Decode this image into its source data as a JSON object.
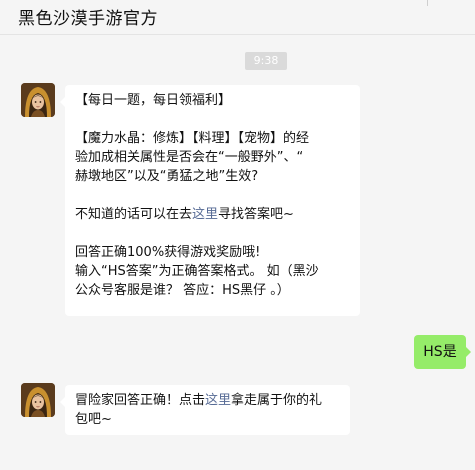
{
  "window": {
    "title": "黑色沙漠手游官方"
  },
  "chat": {
    "timestamp": "9:38",
    "message1": {
      "line1": "【每日一题，每日领福利】",
      "line2": "【魔力水晶：修炼】【料理】【宠物】的经",
      "line3": "验加成相关属性是否会在“一般野外”、“",
      "line4": "赫墩地区”以及“勇猛之地”生效?",
      "line5_before": "不知道的话可以在去",
      "line5_link": "这里",
      "line5_after": "寻找答案吧~",
      "line6": "回答正确100%获得游戏奖励哦!",
      "line7": "输入“HS答案”为正确答案格式。 如（黑沙",
      "line8": "公众号客服是谁？ 答应：HS黑仔 。）"
    },
    "user_message": "HS是",
    "message2": {
      "line1_before": "冒险家回答正确！点击",
      "line1_link": "这里",
      "line1_after": "拿走属于你的礼",
      "line2": "包吧~"
    }
  },
  "colors": {
    "background": "#f5f5f5",
    "bubble_left": "#ffffff",
    "bubble_right": "#95ec69",
    "link": "#576b95",
    "timestamp_bg": "#dadada"
  },
  "icons": {
    "avatar": "avatar-hooded-character"
  }
}
